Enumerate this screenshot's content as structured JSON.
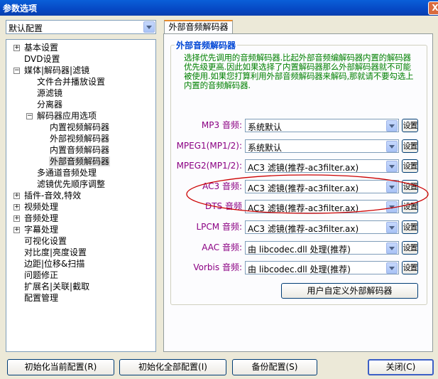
{
  "window": {
    "title": "参数选项",
    "close_label": "X"
  },
  "profile": {
    "selected": "默认配置"
  },
  "tree": [
    {
      "label": "基本设置",
      "expander": "+"
    },
    {
      "label": "DVD设置",
      "expander": ""
    },
    {
      "label": "媒体|解码器|滤镜",
      "expander": "−"
    },
    {
      "label": "文件合并播放设置",
      "expander": ""
    },
    {
      "label": "源滤镜",
      "expander": ""
    },
    {
      "label": "分离器",
      "expander": ""
    },
    {
      "label": "解码器应用选项",
      "expander": "−"
    },
    {
      "label": "内置视频解码器",
      "expander": ""
    },
    {
      "label": "外部视频解码器",
      "expander": ""
    },
    {
      "label": "内置音频解码器",
      "expander": ""
    },
    {
      "label": "外部音频解码器",
      "expander": ""
    },
    {
      "label": "多通道音频处理",
      "expander": ""
    },
    {
      "label": "滤镜优先顺序调整",
      "expander": ""
    },
    {
      "label": "插件-音效,特效",
      "expander": "+"
    },
    {
      "label": "视频处理",
      "expander": "+"
    },
    {
      "label": "音频处理",
      "expander": "+"
    },
    {
      "label": "字幕处理",
      "expander": "+"
    },
    {
      "label": "可视化设置",
      "expander": ""
    },
    {
      "label": "对比度|亮度设置",
      "expander": ""
    },
    {
      "label": "边距|位移&扫描",
      "expander": ""
    },
    {
      "label": "问题修正",
      "expander": ""
    },
    {
      "label": "扩展名|关联|截取",
      "expander": ""
    },
    {
      "label": "配置管理",
      "expander": ""
    }
  ],
  "tab": {
    "label": "外部音频解码器"
  },
  "group": {
    "title": "外部音频解码器",
    "description": "选择优先调用的音频解码器.比起外部音频编解码器内置的解码器优先级更高.因此如果选择了内置解码器那么外部解码器就不可能被使用.如果您打算利用外部音频解码器来解码,那就请不要勾选上内置的音频解码器."
  },
  "decoders": [
    {
      "label": "MP3 音频:",
      "value": "系统默认",
      "button": "设置"
    },
    {
      "label": "MPEG1(MP1/2):",
      "value": "系统默认",
      "button": "设置"
    },
    {
      "label": "MPEG2(MP1/2):",
      "value": "AC3 滤镜(推荐-ac3filter.ax)",
      "button": "设置"
    },
    {
      "label": "AC3 音频:",
      "value": "AC3 滤镜(推荐-ac3filter.ax)",
      "button": "设置"
    },
    {
      "label": "DTS 音频",
      "value": "AC3 滤镜(推荐-ac3filter.ax)",
      "button": "设置"
    },
    {
      "label": "LPCM 音频:",
      "value": "AC3 滤镜(推荐-ac3filter.ax)",
      "button": "设置"
    },
    {
      "label": "AAC 音频:",
      "value": "由 libcodec.dll 处理(推荐)",
      "button": "设置"
    },
    {
      "label": "Vorbis 音频:",
      "value": "由 libcodec.dll 处理(推荐)",
      "button": "设置"
    }
  ],
  "custom_button": "用户自定义外部解码器",
  "bottom": {
    "init_current": "初始化当前配置(R)",
    "init_all": "初始化全部配置(I)",
    "backup": "备份配置(S)",
    "close": "关闭(C)"
  },
  "colors": {
    "annotation": "#cc0000",
    "title_bar": "#0648c4",
    "label": "#8b0083",
    "desc": "#008000"
  }
}
